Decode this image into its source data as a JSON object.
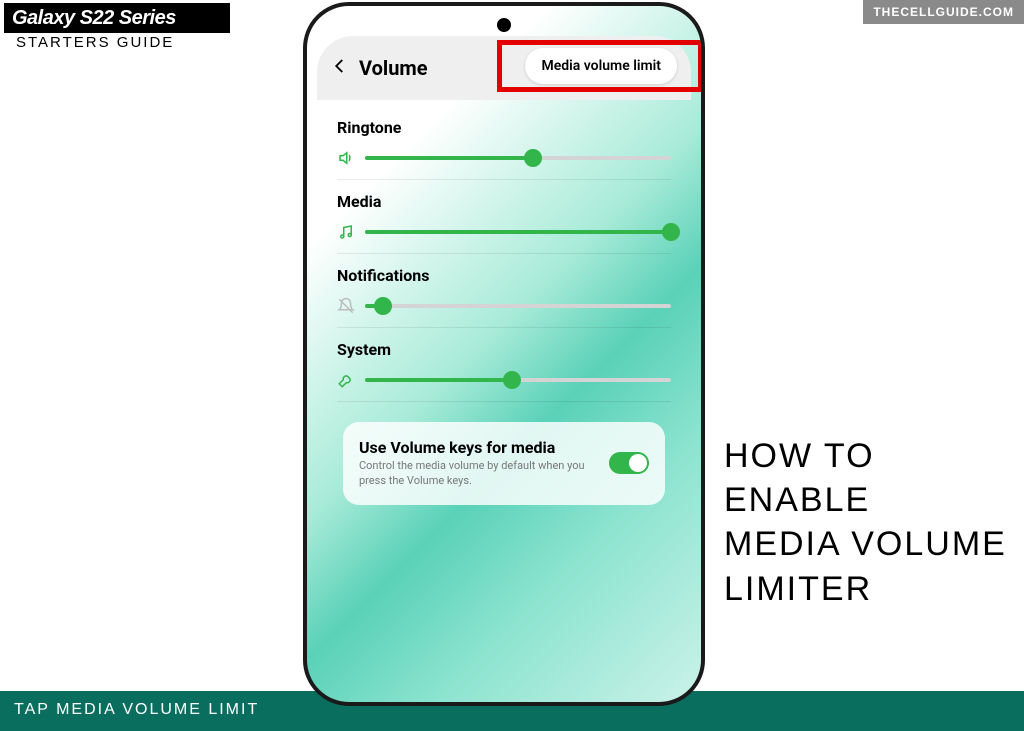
{
  "branding": {
    "logo": "Galaxy S22 Series",
    "starters": "STARTERS GUIDE",
    "watermark": "THECELLGUIDE.COM"
  },
  "hero": "HOW TO\nENABLE\nMEDIA VOLUME\nLIMITER",
  "caption": "TAP MEDIA VOLUME LIMIT",
  "header": {
    "title": "Volume",
    "pill": "Media volume limit"
  },
  "sliders": [
    {
      "label": "Ringtone",
      "value": 55,
      "icon": "speaker"
    },
    {
      "label": "Media",
      "value": 100,
      "icon": "music"
    },
    {
      "label": "Notifications",
      "value": 6,
      "icon": "bell"
    },
    {
      "label": "System",
      "value": 48,
      "icon": "wrench"
    }
  ],
  "card": {
    "title": "Use Volume keys for media",
    "subtitle": "Control the media volume by default when you press the Volume keys.",
    "toggle": true
  }
}
